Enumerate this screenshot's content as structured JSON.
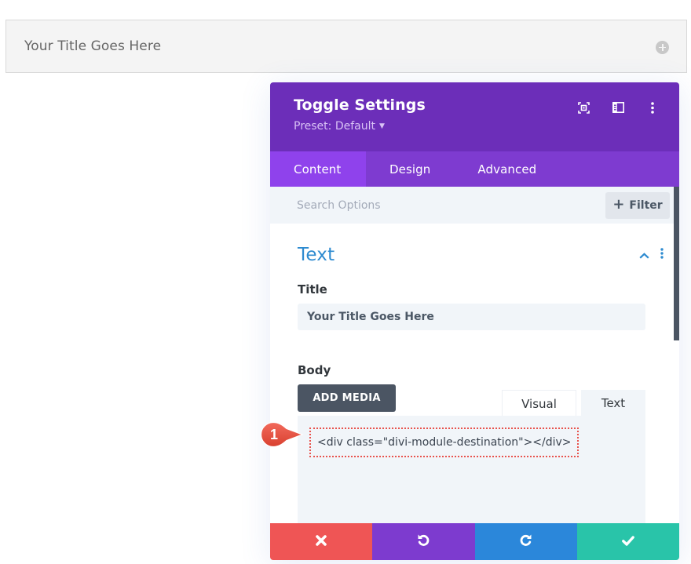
{
  "page_toggle": {
    "title": "Your Title Goes Here",
    "icon": "plus-circle-icon"
  },
  "panel": {
    "title": "Toggle Settings",
    "preset_label": "Preset: Default",
    "header_icons": [
      "expand-icon",
      "sidebar-layout-icon",
      "more-vertical-icon"
    ],
    "tabs": [
      {
        "label": "Content",
        "active": true
      },
      {
        "label": "Design",
        "active": false
      },
      {
        "label": "Advanced",
        "active": false
      }
    ],
    "search": {
      "placeholder": "Search Options",
      "value": ""
    },
    "filter_label": "Filter",
    "section": {
      "title": "Text",
      "expanded": true
    },
    "fields": {
      "title_label": "Title",
      "title_value": "Your Title Goes Here",
      "body_label": "Body",
      "add_media_label": "ADD MEDIA",
      "editor_tabs": [
        {
          "label": "Visual",
          "active": false
        },
        {
          "label": "Text",
          "active": true
        }
      ],
      "body_code": "<div class=\"divi-module-destination\"></div>"
    },
    "footer_buttons": [
      {
        "name": "cancel",
        "icon": "close-icon",
        "color": "#ef5555"
      },
      {
        "name": "undo",
        "icon": "undo-icon",
        "color": "#7d3bcf"
      },
      {
        "name": "redo",
        "icon": "redo-icon",
        "color": "#2b87da"
      },
      {
        "name": "save",
        "icon": "check-icon",
        "color": "#29c4a9"
      }
    ]
  },
  "annotation": {
    "callout_number": "1",
    "color": "#e8534d"
  },
  "colors": {
    "header_purple": "#6c2eb9",
    "tab_bar_purple": "#7e3bd0",
    "active_tab_purple": "#8f42ec",
    "section_title_blue": "#2e8bd0"
  }
}
